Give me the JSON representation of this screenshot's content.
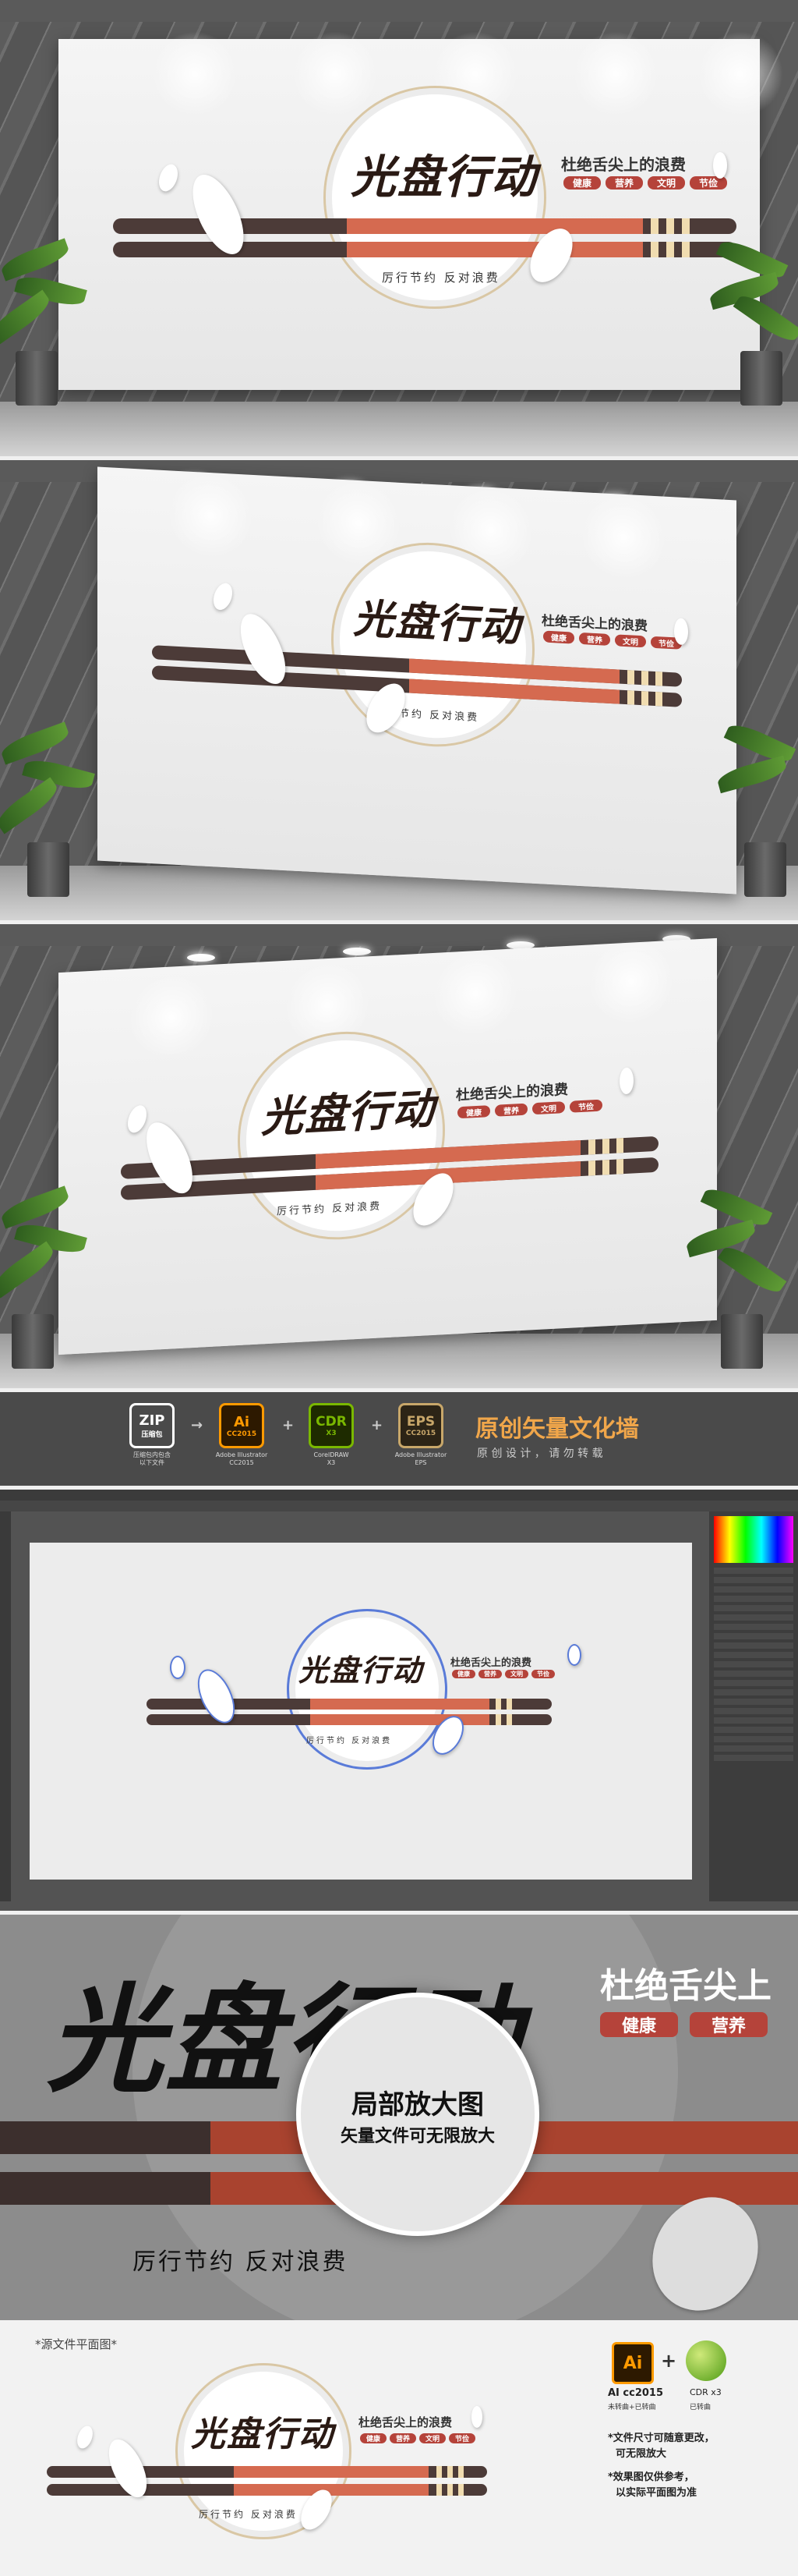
{
  "sign": {
    "title": "光盘行动",
    "subtitle": "杜绝舌尖上的浪费",
    "tags": [
      "健康",
      "营养",
      "文明",
      "节俭"
    ],
    "motto": "厉行节约  反对浪费"
  },
  "formats": {
    "items": [
      {
        "label": "ZIP",
        "sub": "压缩包",
        "caption": "压缩包内包含\n以下文件",
        "color": "#ffffff"
      },
      {
        "label": "Ai",
        "sub": "CC2015",
        "caption": "Adobe Illustrator\nCC2015",
        "color": "#ff9a00"
      },
      {
        "label": "CDR",
        "sub": "X3",
        "caption": "CorelDRAW\nX3",
        "color": "#7ab800"
      },
      {
        "label": "EPS",
        "sub": "CC2015",
        "caption": "Adobe Illustrator\nEPS",
        "color": "#c8a76a"
      }
    ],
    "separators": [
      "→",
      "+",
      "+"
    ],
    "headline": "原创矢量文化墙",
    "tagline": "原 创 设 计 ， 请 勿 转 载"
  },
  "zoom": {
    "title": "局部放大图",
    "caption": "矢量文件可无限放大",
    "subtitle_partial": "杜绝舌尖上",
    "tags": [
      "健康",
      "营养"
    ]
  },
  "flat": {
    "label": "*源文件平面图*",
    "ai_version": "AI cc2015",
    "ai_note": "未转曲+已转曲",
    "cdr_version": "CDR x3",
    "cdr_note": "已转曲",
    "notes": [
      "*文件尺寸可随意更改，",
      "可无限放大",
      "*效果图仅供参考，",
      "以实际平面图为准"
    ]
  }
}
